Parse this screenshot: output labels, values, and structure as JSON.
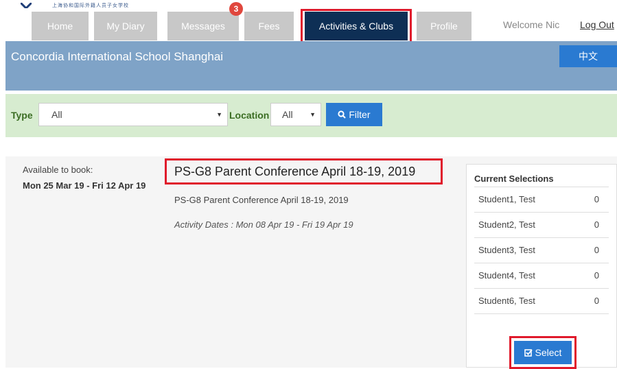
{
  "header": {
    "logo_text": "上海协和国际外籍人员子女学校",
    "tabs": [
      {
        "label": "Home"
      },
      {
        "label": "My Diary"
      },
      {
        "label": "Messages",
        "badge": "3"
      },
      {
        "label": "Fees"
      },
      {
        "label": "Activities & Clubs",
        "active": true
      },
      {
        "label": "Profile"
      }
    ],
    "welcome": "Welcome Nic",
    "logout": "Log Out"
  },
  "banner": {
    "school_name": "Concordia International School Shanghai",
    "lang_button": "中文"
  },
  "filter": {
    "type_label": "Type",
    "type_value": "All",
    "location_label": "Location",
    "location_value": "All",
    "filter_button": "Filter"
  },
  "activity": {
    "available_label": "Available to book:",
    "available_dates": "Mon 25 Mar 19 - Fri 12 Apr 19",
    "title": "PS-G8 Parent Conference April 18-19, 2019",
    "description": "PS-G8 Parent Conference April 18-19, 2019",
    "activity_dates": "Activity Dates : Mon 08 Apr 19 - Fri 19 Apr 19"
  },
  "selections": {
    "title": "Current Selections",
    "students": [
      {
        "name": "Student1, Test",
        "count": "0"
      },
      {
        "name": "Student2, Test",
        "count": "0"
      },
      {
        "name": "Student3, Test",
        "count": "0"
      },
      {
        "name": "Student4, Test",
        "count": "0"
      },
      {
        "name": "Student6, Test",
        "count": "0"
      }
    ],
    "select_button": "Select"
  },
  "colors": {
    "nav_active": "#0e2f55",
    "nav_inactive": "#c8c8c8",
    "banner": "#7fa3c7",
    "filter_bar": "#d7ecd0",
    "button": "#2a7ad1",
    "highlight": "#e0192b"
  }
}
